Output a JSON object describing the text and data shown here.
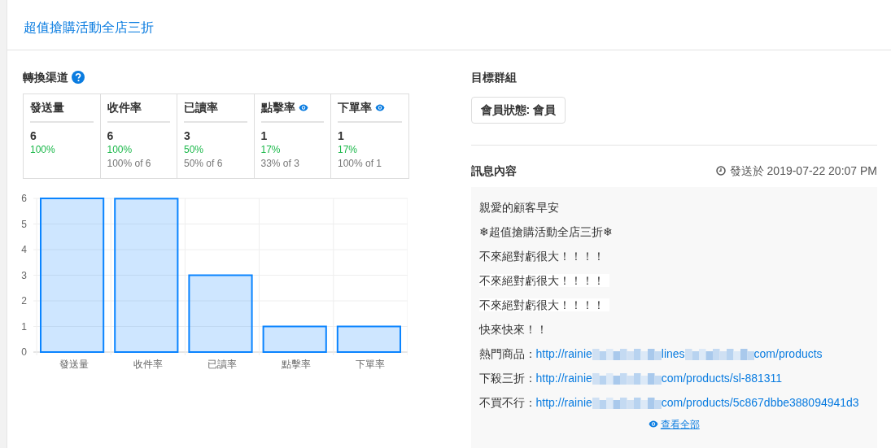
{
  "header": {
    "title": "超值搶購活動全店三折"
  },
  "funnel": {
    "title": "轉換渠道",
    "columns": [
      {
        "label": "發送量",
        "eye": false,
        "count": "6",
        "rate": "100%"
      },
      {
        "label": "收件率",
        "eye": false,
        "count": "6",
        "rate": "100%",
        "of": "100% of 6"
      },
      {
        "label": "已讀率",
        "eye": false,
        "count": "3",
        "rate": "50%",
        "of": "50% of 6"
      },
      {
        "label": "點擊率",
        "eye": true,
        "count": "1",
        "rate": "17%",
        "of": "33% of 3"
      },
      {
        "label": "下單率",
        "eye": true,
        "count": "1",
        "rate": "17%",
        "of": "100% of 1"
      }
    ],
    "chart_data": {
      "type": "bar",
      "categories": [
        "發送量",
        "收件率",
        "已讀率",
        "點擊率",
        "下單率"
      ],
      "series": [
        {
          "color": "#0a84ff",
          "values": [
            6,
            5.99,
            3,
            1,
            1
          ]
        }
      ],
      "grid": true,
      "ylim": [
        0,
        6
      ],
      "yticks": [
        0,
        1,
        2,
        3,
        4,
        5,
        6
      ]
    }
  },
  "target": {
    "title": "目標群組",
    "tags": [
      "會員狀態: 會員"
    ]
  },
  "message": {
    "title": "訊息內容",
    "sent": "發送於 2019-07-22 20:07 PM",
    "lines": [
      {
        "kind": "text",
        "text": "親愛的顧客早安",
        "highlighted": false
      },
      {
        "kind": "text",
        "text": "❄超值搶購活動全店三折❄",
        "highlighted": false
      },
      {
        "kind": "text",
        "text": "不來絕對虧很大！！！！",
        "highlighted": false
      },
      {
        "kind": "text",
        "text": "不來絕對虧很大！！！！",
        "highlighted": true
      },
      {
        "kind": "text",
        "text": "不來絕對虧很大！！！！",
        "highlighted": true
      },
      {
        "kind": "text",
        "text": "快來快來！！",
        "highlighted": false
      },
      {
        "kind": "link",
        "label": "熱門商品：",
        "parts": [
          "http://rainie",
          "lines",
          "com/products"
        ]
      },
      {
        "kind": "link",
        "label": "下殺三折：",
        "parts": [
          "http://rainie",
          "com/products/sl-881311"
        ]
      },
      {
        "kind": "link",
        "label": "不買不行：",
        "parts": [
          "http://rainie",
          "com/products/5c867dbbe388094941d3"
        ]
      }
    ],
    "view_all": "查看全部"
  }
}
